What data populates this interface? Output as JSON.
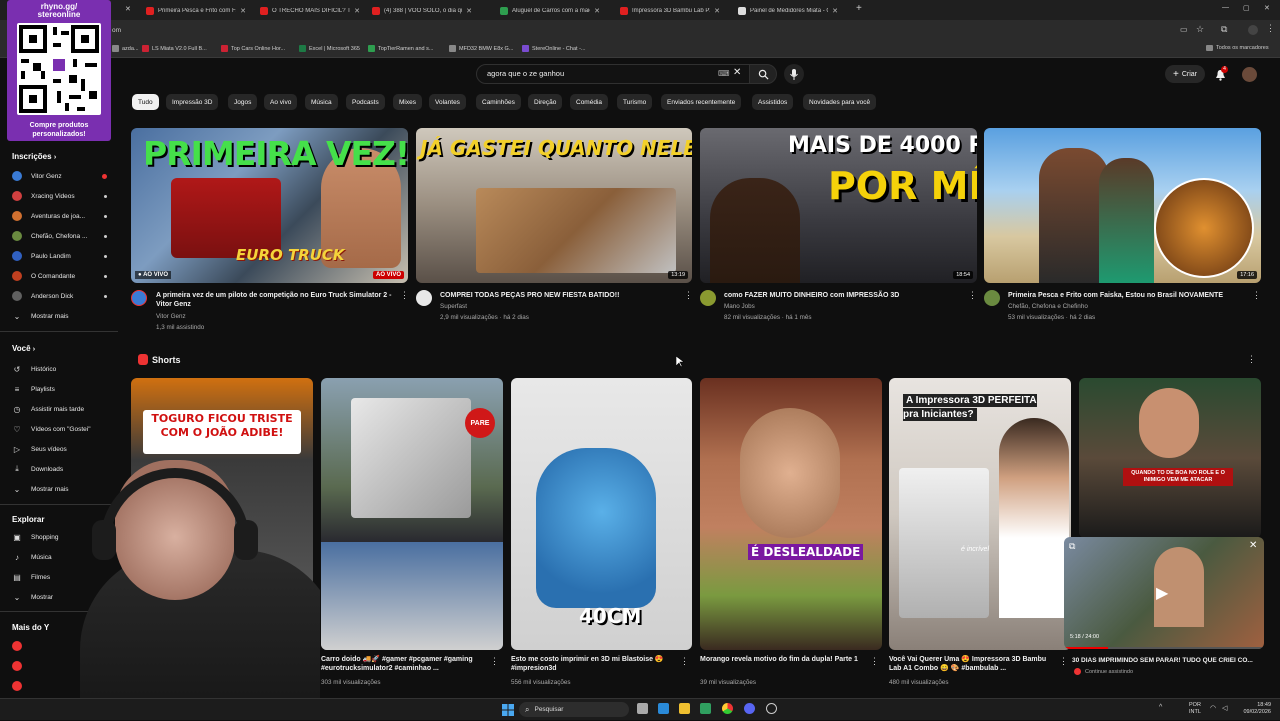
{
  "browser": {
    "tabs": [
      {
        "title": "Primeira Pesca e Frito com Faisk",
        "color": "#e02020"
      },
      {
        "title": "O TRECHO MAIS DIFÍCIL? Trazen",
        "color": "#e02020"
      },
      {
        "title": "(4) 388 | VOO SOLO, o dia que",
        "color": "#e02020"
      },
      {
        "title": "Aluguel de Carros com a maior",
        "color": "#2e9e4f"
      },
      {
        "title": "Impressora 3D Bambu Lab P2S",
        "color": "#e02020"
      },
      {
        "title": "Painel de Medidores Miata - Q",
        "color": "#dddddd"
      }
    ],
    "address_suffix": "om",
    "bookmarks": [
      {
        "label": "azda...",
        "color": "#888888"
      },
      {
        "label": "LS Miata V2.0 Full B...",
        "color": "#c23"
      },
      {
        "label": "Top Cars Online Hor...",
        "color": "#c23"
      },
      {
        "label": "Excel | Microsoft 365",
        "color": "#1d7a45"
      },
      {
        "label": "TopTierRamen and s...",
        "color": "#2e9e4f"
      },
      {
        "label": "MFD32 BMW E8x G...",
        "color": "#888888"
      },
      {
        "label": "StereOnline - Chat -...",
        "color": "#7a4cd0"
      }
    ],
    "bookmarks_all": "Todos os marcadores"
  },
  "promo": {
    "line1": "rhyno.gg/",
    "line2": "stereonline",
    "line3": "Compre produtos",
    "line4": "personalizados!"
  },
  "sidebar": {
    "subscriptions_title": "Inscrições",
    "subscriptions": [
      {
        "label": "Vitor Genz",
        "color": "#3a7bd5",
        "live": true
      },
      {
        "label": "Xracing Videos",
        "color": "#d04040",
        "live": false
      },
      {
        "label": "Aventuras de joa...",
        "color": "#d07030",
        "live": false
      },
      {
        "label": "Chefão, Chefona ...",
        "color": "#6a8a40",
        "live": false
      },
      {
        "label": "Paulo Landim",
        "color": "#3060c0",
        "live": false
      },
      {
        "label": "O Comandante",
        "color": "#c04020",
        "live": false
      },
      {
        "label": "Anderson Dick",
        "color": "#606060",
        "live": false
      }
    ],
    "show_more": "Mostrar mais",
    "you_title": "Você",
    "you_items": [
      {
        "label": "Histórico",
        "icon": "history-icon"
      },
      {
        "label": "Playlists",
        "icon": "playlist-icon"
      },
      {
        "label": "Assistir mais tarde",
        "icon": "clock-icon"
      },
      {
        "label": "Vídeos com \"Gostei\"",
        "icon": "like-icon"
      },
      {
        "label": "Seus vídeos",
        "icon": "video-icon"
      },
      {
        "label": "Downloads",
        "icon": "download-icon"
      },
      {
        "label": "Mostrar mais",
        "icon": "chevron-down-icon"
      }
    ],
    "explore_title": "Explorar",
    "explore_items": [
      {
        "label": "Shopping",
        "icon": "bag-icon"
      },
      {
        "label": "Música",
        "icon": "music-icon"
      },
      {
        "label": "Filmes",
        "icon": "film-icon"
      },
      {
        "label": "Mostrar",
        "icon": "chevron-down-icon"
      }
    ],
    "more_title": "Mais do Y"
  },
  "header": {
    "search_value": "agora que o ze ganhou",
    "create_label": "Criar",
    "notification_count": "4"
  },
  "chips": [
    "Tudo",
    "Impressão 3D",
    "Jogos",
    "Ao vivo",
    "Música",
    "Podcasts",
    "Mixes",
    "Volantes",
    "Caminhões",
    "Direção",
    "Comédia",
    "Turismo",
    "Enviados recentemente",
    "Assistidos",
    "Novidades para você"
  ],
  "videos": [
    {
      "title": "A primeira vez de um piloto de competição no Euro Truck Simulator 2 - Vitor Genz",
      "channel": "Vitor Genz",
      "meta": "1,3 mil assistindo",
      "overlay": "PRIMEIRA VEZ!",
      "sub_overlay": "EURO TRUCK",
      "badge": "AO VIVO",
      "duration": "",
      "live": true
    },
    {
      "title": "COMPREI TODAS PEÇAS PRO NEW FIESTA BATIDO!!",
      "channel": "Superfast",
      "meta": "2,9 mil visualizações · há 2 dias",
      "overlay": "JÁ GASTEI QUANTO NELE?",
      "duration": "13:19"
    },
    {
      "title": "como FAZER MUITO DINHEIRO com IMPRESSÃO 3D",
      "channel": "Mano Jobs",
      "meta": "82 mil visualizações · há 1 mês",
      "overlay": "MAIS DE 4000 REAIS",
      "sub_overlay": "POR MÊS",
      "duration": "18:54"
    },
    {
      "title": "Primeira Pesca e Frito com Faiska, Estou no Brasil NOVAMENTE",
      "channel": "Chefão, Chefona e Chefinho",
      "meta": "53 mil visualizações · há 2 dias",
      "duration": "17:16"
    }
  ],
  "shorts_title": "Shorts",
  "shorts": [
    {
      "title": "",
      "views": "",
      "overlay": "TOGURO FICOU TRISTE COM O JOÃO ADIBE!"
    },
    {
      "title": "Carro doido 🚚🚀 #gamer #pcgamer #gaming #eurotrucksimulator2 #caminhao ...",
      "views": "303 mil visualizações",
      "overlay": "PARE"
    },
    {
      "title": "Esto me costo imprimir en 3D mi Blastoise 😍 #impresion3d",
      "views": "556 mil visualizações",
      "overlay": "40CM"
    },
    {
      "title": "Morango revela motivo do fim da dupla! Parte 1",
      "views": "39 mil visualizações",
      "overlay": "É DESLEALDADE"
    },
    {
      "title": "Você Vai Querer Uma 😍 Impressora 3D Bambu Lab A1 Combo 😄 🎨 #bambulab ...",
      "views": "480 mil visualizações",
      "overlay": "A Impressora 3D PERFEITA pra Iniciantes?",
      "sub_overlay": "é incrível"
    },
    {
      "title": "30 DIAS IMPRIMINDO SEM PARAR! TUDO QUE CRIEI CO...",
      "views": "",
      "overlay": "QUANDO TO DE BOA NO ROLE E O INIMIGO VEM ME ATACAR",
      "miniplayer_time": "5:18 / 24:00",
      "miniplayer_sub": "Continue assistindo"
    }
  ],
  "taskbar": {
    "search": "Pesquisar",
    "lang1": "POR",
    "lang2": "INTL",
    "time": "18:49",
    "date": "09/02/2026"
  }
}
